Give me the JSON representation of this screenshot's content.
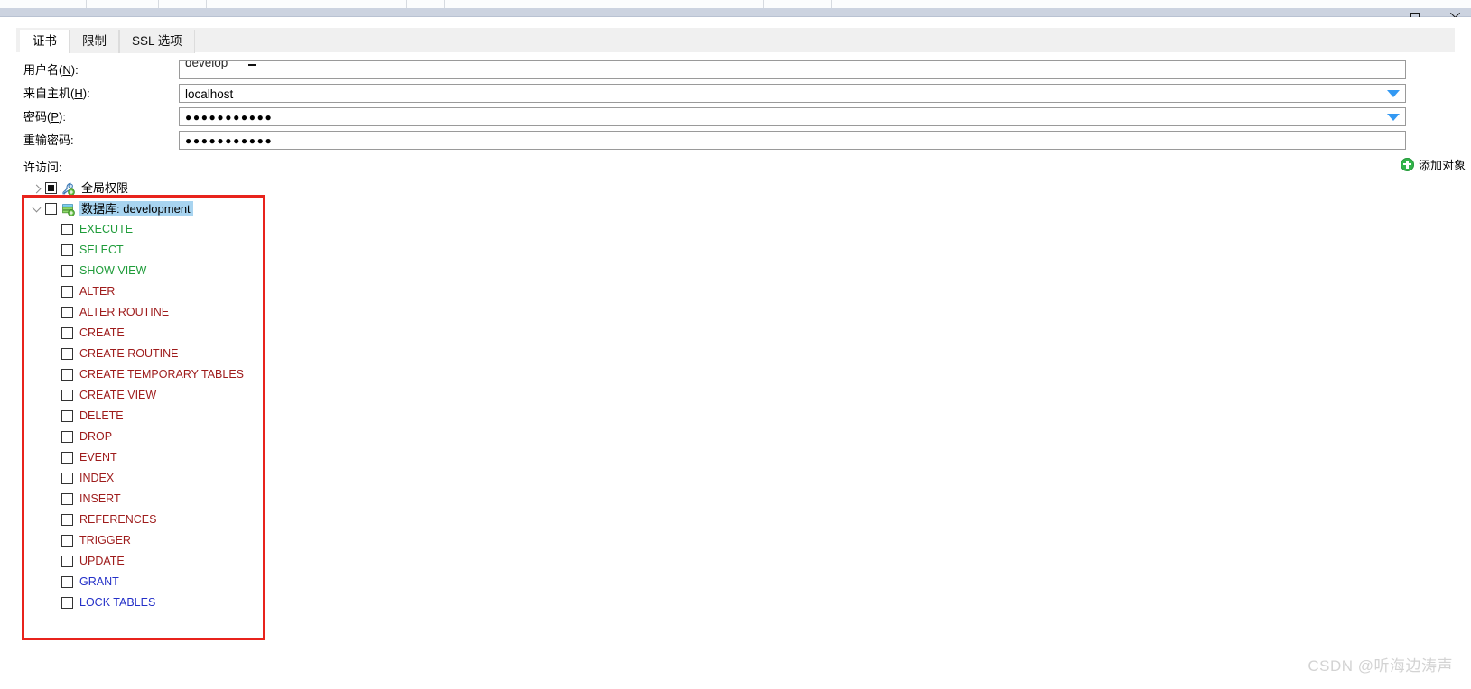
{
  "window": {
    "maximize_icon": "maximize-icon",
    "close_icon": "close-icon"
  },
  "tabs": [
    {
      "label": "证书",
      "active": true
    },
    {
      "label": "限制",
      "active": false
    },
    {
      "label": "SSL 选项",
      "active": false
    }
  ],
  "form": {
    "rows": [
      {
        "label_prefix": "用户名(",
        "accel": "N",
        "label_suffix": "):",
        "value": "develop",
        "type": "text",
        "clipped": true,
        "dropdown": false,
        "name": "username"
      },
      {
        "label_prefix": "来自主机(",
        "accel": "H",
        "label_suffix": "):",
        "value": "localhost",
        "type": "text",
        "clipped": false,
        "dropdown": true,
        "name": "host"
      },
      {
        "label_prefix": "密码(",
        "accel": "P",
        "label_suffix": "):",
        "value": "●●●●●●●●●●●",
        "type": "password",
        "clipped": false,
        "dropdown": true,
        "name": "password"
      },
      {
        "label_prefix": "重输密码",
        "accel": "",
        "label_suffix": ":",
        "value": "●●●●●●●●●●●",
        "type": "password",
        "clipped": false,
        "dropdown": false,
        "name": "password-repeat"
      }
    ]
  },
  "access": {
    "section_label": "许访问:",
    "add_object_label": "添加对象",
    "add_object_icon": "plus-circle-icon"
  },
  "tree": {
    "global_node": {
      "label": "全局权限",
      "expanded": false,
      "checkbox_state": "indeterminate",
      "icon": "key-icon"
    },
    "database_node": {
      "label": "数据库: development",
      "expanded": true,
      "checkbox_state": "unchecked",
      "selected": true,
      "icon": "database-icon"
    },
    "permissions": [
      {
        "label": "EXECUTE",
        "color": "#1f9c3a",
        "checked": false
      },
      {
        "label": "SELECT",
        "color": "#1f9c3a",
        "checked": false
      },
      {
        "label": "SHOW VIEW",
        "color": "#1f9c3a",
        "checked": false
      },
      {
        "label": "ALTER",
        "color": "#9e1b1b",
        "checked": false
      },
      {
        "label": "ALTER ROUTINE",
        "color": "#9e1b1b",
        "checked": false
      },
      {
        "label": "CREATE",
        "color": "#9e1b1b",
        "checked": false
      },
      {
        "label": "CREATE ROUTINE",
        "color": "#9e1b1b",
        "checked": false
      },
      {
        "label": "CREATE TEMPORARY TABLES",
        "color": "#9e1b1b",
        "checked": false
      },
      {
        "label": "CREATE VIEW",
        "color": "#9e1b1b",
        "checked": false
      },
      {
        "label": "DELETE",
        "color": "#9e1b1b",
        "checked": false
      },
      {
        "label": "DROP",
        "color": "#9e1b1b",
        "checked": false
      },
      {
        "label": "EVENT",
        "color": "#9e1b1b",
        "checked": false
      },
      {
        "label": "INDEX",
        "color": "#9e1b1b",
        "checked": false
      },
      {
        "label": "INSERT",
        "color": "#9e1b1b",
        "checked": false
      },
      {
        "label": "REFERENCES",
        "color": "#9e1b1b",
        "checked": false
      },
      {
        "label": "TRIGGER",
        "color": "#9e1b1b",
        "checked": false
      },
      {
        "label": "UPDATE",
        "color": "#9e1b1b",
        "checked": false
      },
      {
        "label": "GRANT",
        "color": "#2430c8",
        "checked": false
      },
      {
        "label": "LOCK TABLES",
        "color": "#2430c8",
        "checked": false
      }
    ]
  },
  "annotation": {
    "box_color": "#e8231c"
  },
  "watermark": {
    "text": "CSDN @听海边涛声"
  }
}
